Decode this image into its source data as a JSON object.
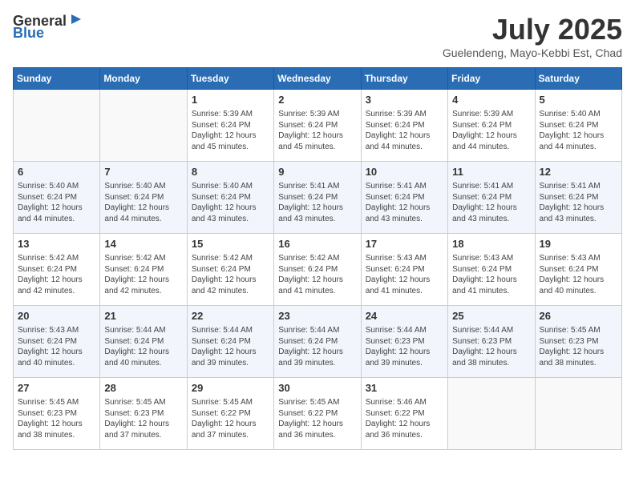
{
  "header": {
    "logo_general": "General",
    "logo_blue": "Blue",
    "month_year": "July 2025",
    "location": "Guelendeng, Mayo-Kebbi Est, Chad"
  },
  "weekdays": [
    "Sunday",
    "Monday",
    "Tuesday",
    "Wednesday",
    "Thursday",
    "Friday",
    "Saturday"
  ],
  "weeks": [
    [
      {
        "day": "",
        "info": ""
      },
      {
        "day": "",
        "info": ""
      },
      {
        "day": "1",
        "info": "Sunrise: 5:39 AM\nSunset: 6:24 PM\nDaylight: 12 hours and 45 minutes."
      },
      {
        "day": "2",
        "info": "Sunrise: 5:39 AM\nSunset: 6:24 PM\nDaylight: 12 hours and 45 minutes."
      },
      {
        "day": "3",
        "info": "Sunrise: 5:39 AM\nSunset: 6:24 PM\nDaylight: 12 hours and 44 minutes."
      },
      {
        "day": "4",
        "info": "Sunrise: 5:39 AM\nSunset: 6:24 PM\nDaylight: 12 hours and 44 minutes."
      },
      {
        "day": "5",
        "info": "Sunrise: 5:40 AM\nSunset: 6:24 PM\nDaylight: 12 hours and 44 minutes."
      }
    ],
    [
      {
        "day": "6",
        "info": "Sunrise: 5:40 AM\nSunset: 6:24 PM\nDaylight: 12 hours and 44 minutes."
      },
      {
        "day": "7",
        "info": "Sunrise: 5:40 AM\nSunset: 6:24 PM\nDaylight: 12 hours and 44 minutes."
      },
      {
        "day": "8",
        "info": "Sunrise: 5:40 AM\nSunset: 6:24 PM\nDaylight: 12 hours and 43 minutes."
      },
      {
        "day": "9",
        "info": "Sunrise: 5:41 AM\nSunset: 6:24 PM\nDaylight: 12 hours and 43 minutes."
      },
      {
        "day": "10",
        "info": "Sunrise: 5:41 AM\nSunset: 6:24 PM\nDaylight: 12 hours and 43 minutes."
      },
      {
        "day": "11",
        "info": "Sunrise: 5:41 AM\nSunset: 6:24 PM\nDaylight: 12 hours and 43 minutes."
      },
      {
        "day": "12",
        "info": "Sunrise: 5:41 AM\nSunset: 6:24 PM\nDaylight: 12 hours and 43 minutes."
      }
    ],
    [
      {
        "day": "13",
        "info": "Sunrise: 5:42 AM\nSunset: 6:24 PM\nDaylight: 12 hours and 42 minutes."
      },
      {
        "day": "14",
        "info": "Sunrise: 5:42 AM\nSunset: 6:24 PM\nDaylight: 12 hours and 42 minutes."
      },
      {
        "day": "15",
        "info": "Sunrise: 5:42 AM\nSunset: 6:24 PM\nDaylight: 12 hours and 42 minutes."
      },
      {
        "day": "16",
        "info": "Sunrise: 5:42 AM\nSunset: 6:24 PM\nDaylight: 12 hours and 41 minutes."
      },
      {
        "day": "17",
        "info": "Sunrise: 5:43 AM\nSunset: 6:24 PM\nDaylight: 12 hours and 41 minutes."
      },
      {
        "day": "18",
        "info": "Sunrise: 5:43 AM\nSunset: 6:24 PM\nDaylight: 12 hours and 41 minutes."
      },
      {
        "day": "19",
        "info": "Sunrise: 5:43 AM\nSunset: 6:24 PM\nDaylight: 12 hours and 40 minutes."
      }
    ],
    [
      {
        "day": "20",
        "info": "Sunrise: 5:43 AM\nSunset: 6:24 PM\nDaylight: 12 hours and 40 minutes."
      },
      {
        "day": "21",
        "info": "Sunrise: 5:44 AM\nSunset: 6:24 PM\nDaylight: 12 hours and 40 minutes."
      },
      {
        "day": "22",
        "info": "Sunrise: 5:44 AM\nSunset: 6:24 PM\nDaylight: 12 hours and 39 minutes."
      },
      {
        "day": "23",
        "info": "Sunrise: 5:44 AM\nSunset: 6:24 PM\nDaylight: 12 hours and 39 minutes."
      },
      {
        "day": "24",
        "info": "Sunrise: 5:44 AM\nSunset: 6:23 PM\nDaylight: 12 hours and 39 minutes."
      },
      {
        "day": "25",
        "info": "Sunrise: 5:44 AM\nSunset: 6:23 PM\nDaylight: 12 hours and 38 minutes."
      },
      {
        "day": "26",
        "info": "Sunrise: 5:45 AM\nSunset: 6:23 PM\nDaylight: 12 hours and 38 minutes."
      }
    ],
    [
      {
        "day": "27",
        "info": "Sunrise: 5:45 AM\nSunset: 6:23 PM\nDaylight: 12 hours and 38 minutes."
      },
      {
        "day": "28",
        "info": "Sunrise: 5:45 AM\nSunset: 6:23 PM\nDaylight: 12 hours and 37 minutes."
      },
      {
        "day": "29",
        "info": "Sunrise: 5:45 AM\nSunset: 6:22 PM\nDaylight: 12 hours and 37 minutes."
      },
      {
        "day": "30",
        "info": "Sunrise: 5:45 AM\nSunset: 6:22 PM\nDaylight: 12 hours and 36 minutes."
      },
      {
        "day": "31",
        "info": "Sunrise: 5:46 AM\nSunset: 6:22 PM\nDaylight: 12 hours and 36 minutes."
      },
      {
        "day": "",
        "info": ""
      },
      {
        "day": "",
        "info": ""
      }
    ]
  ]
}
